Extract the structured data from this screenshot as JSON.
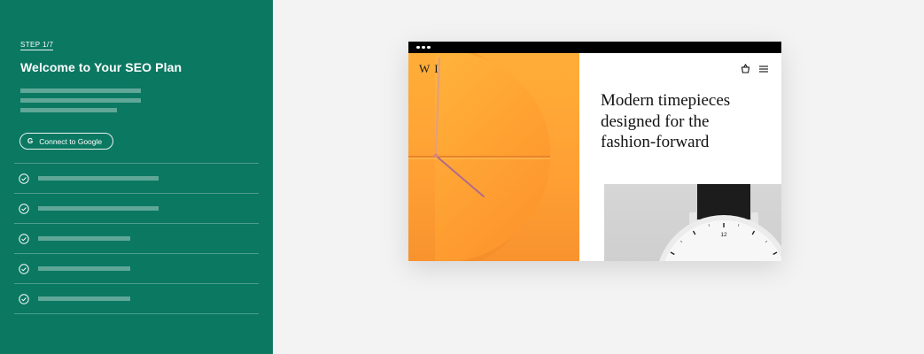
{
  "panel": {
    "step_label": "STEP 1/7",
    "title": "Welcome to Your SEO Plan",
    "google_button": {
      "icon": "G",
      "label": "Connect to Google"
    },
    "checklist_icon": "check-circle-icon"
  },
  "preview": {
    "logo": "W I",
    "headline_lines": [
      "Modern timepieces",
      "designed for the",
      "fashion-forward"
    ],
    "watch_numeral": "12",
    "colors": {
      "panel_bg": "#0b7862",
      "hero_orange": "#ffa436",
      "hand_color": "#b06a8a"
    }
  }
}
